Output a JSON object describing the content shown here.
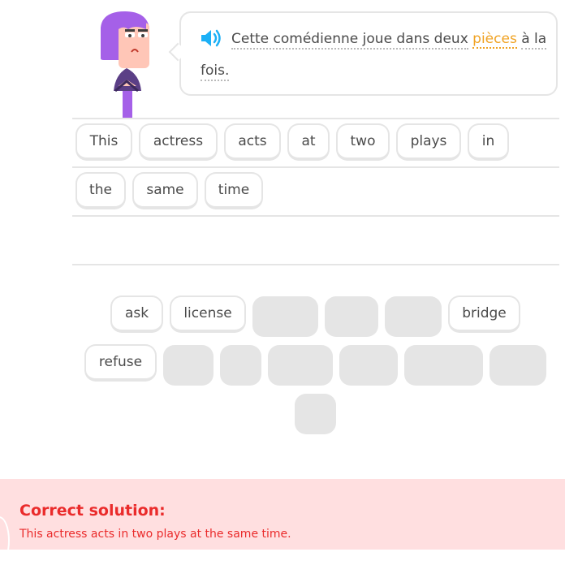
{
  "prompt": {
    "line1_before": "Cette comédienne joue dans deux",
    "highlight": "pièces",
    "line1_after": "à la",
    "line2": "fois."
  },
  "answer_tiles": [
    {
      "label": "This"
    },
    {
      "label": "actress"
    },
    {
      "label": "acts"
    },
    {
      "label": "at"
    },
    {
      "label": "two"
    },
    {
      "label": "plays"
    },
    {
      "label": "in"
    },
    {
      "label": "the"
    },
    {
      "label": "same"
    },
    {
      "label": "time"
    }
  ],
  "bank_tiles": [
    {
      "label": "ask"
    },
    {
      "label": "license"
    },
    {
      "label": "bridge"
    },
    {
      "label": "refuse"
    }
  ],
  "footer": {
    "title": "Correct solution:",
    "solution": "This actress acts in two plays at the same time."
  },
  "colors": {
    "accent_blue": "#1cb0f6",
    "highlight_orange": "#f0a222",
    "error_red": "#ea2b2b",
    "footer_bg": "#ffdfe0",
    "border_gray": "#e5e5e5",
    "character_purple": "#a560e8"
  }
}
